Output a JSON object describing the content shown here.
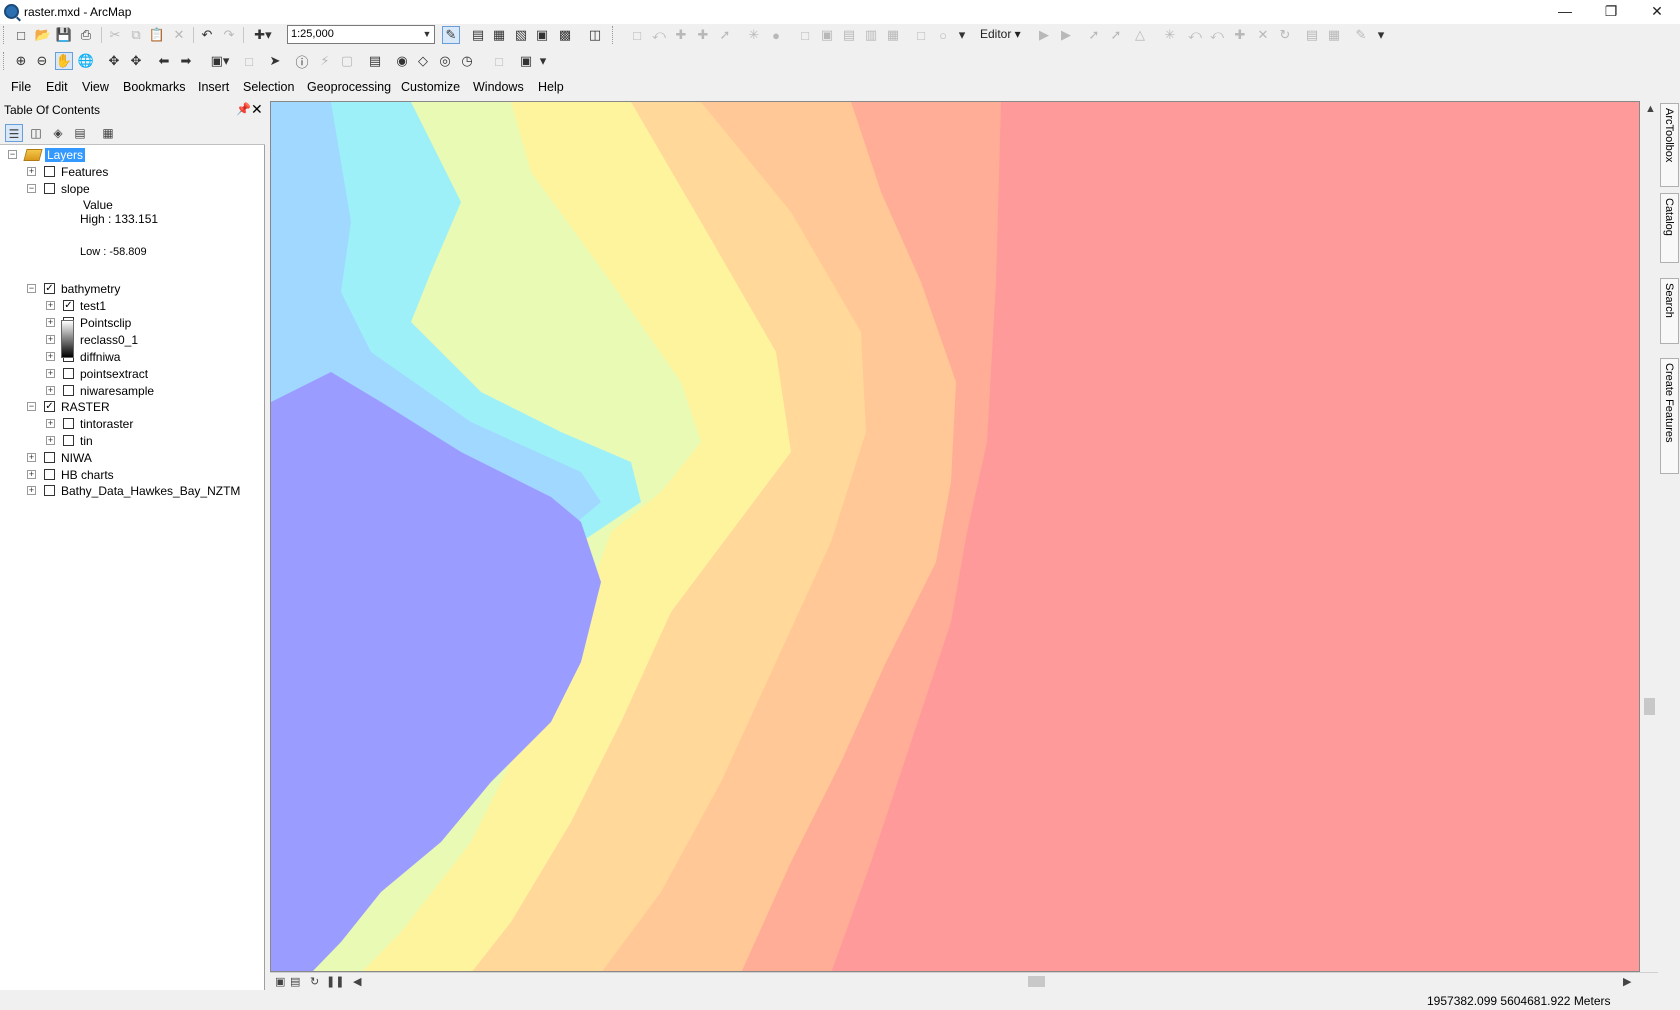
{
  "window": {
    "title": "raster.mxd - ArcMap"
  },
  "toolbar": {
    "scale_value": "1:25,000",
    "editor_label": "Editor ▾"
  },
  "menu": [
    "File",
    "Edit",
    "View",
    "Bookmarks",
    "Insert",
    "Selection",
    "Geoprocessing",
    "Customize",
    "Windows",
    "Help"
  ],
  "toc": {
    "title": "Table Of Contents",
    "root_label": "Layers",
    "items": {
      "features": "Features",
      "slope": "slope",
      "slope_legend_title": "Value",
      "slope_high": "High : 133.151",
      "slope_low": "Low : -58.809",
      "bathymetry": "bathymetry",
      "test1": "test1",
      "pointsclip": "Pointsclip",
      "reclass": "reclass0_1",
      "diffniwa": "diffniwa",
      "pointsextract": "pointsextract",
      "niwaresample": "niwaresample",
      "raster": "RASTER",
      "tintoraster": "tintoraster",
      "tin": "tin",
      "niwa": "NIWA",
      "hbcharts": "HB charts",
      "bathydata": "Bathy_Data_Hawkes_Bay_NZTM"
    }
  },
  "side_tabs": [
    "ArcToolbox",
    "Catalog",
    "Search",
    "Create Features"
  ],
  "status": {
    "coordinates": "1957382.099  5604681.922 Meters"
  },
  "colors": {
    "deep": "#9b9cff",
    "coast": "#ff9a9a",
    "selection": "#3399ff"
  }
}
